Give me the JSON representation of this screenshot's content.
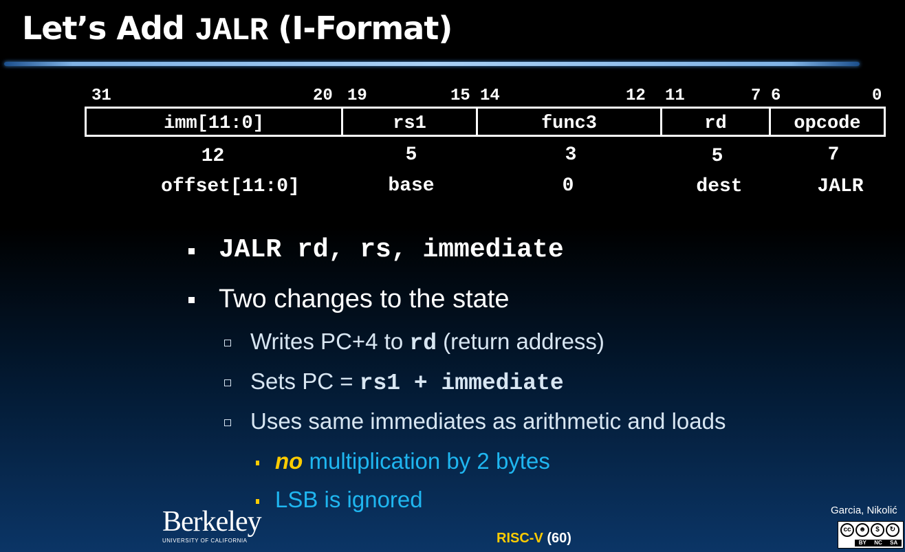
{
  "slide": {
    "title_prefix": "Let’s Add ",
    "title_mono": "JALR",
    "title_suffix": " (I-Format)"
  },
  "format": {
    "bit_labels": [
      "31",
      "20",
      "19",
      "15",
      "14",
      "12",
      "11",
      "7",
      "6",
      "0"
    ],
    "fields": [
      "imm[11:0]",
      "rs1",
      "func3",
      "rd",
      "opcode"
    ],
    "widths": [
      "12",
      "5",
      "3",
      "5",
      "7"
    ],
    "meanings": [
      "offset[11:0]",
      "base",
      "0",
      "dest",
      "JALR"
    ]
  },
  "bullets": {
    "b1": "JALR rd, rs, immediate",
    "b2": "Two changes to the state",
    "b2_1_pre": "Writes PC+4 to ",
    "b2_1_code": "rd",
    "b2_1_post": " (return address)",
    "b2_2_pre": "Sets PC = ",
    "b2_2_code": "rs1 + immediate",
    "b2_3": "Uses same immediates as arithmetic and loads",
    "b3_1_emph": "no",
    "b3_1_rest": " multiplication by 2 bytes",
    "b3_2": "LSB is ignored"
  },
  "footer": {
    "logo_main": "Berkeley",
    "logo_sub": "UNIVERSITY OF CALIFORNIA",
    "center_1": "RISC-V",
    "center_2": " (60)",
    "authors": "Garcia, Nikolić",
    "cc_labels": [
      "BY",
      "NC",
      "SA"
    ]
  },
  "colors": {
    "accent_yellow": "#ffcc00",
    "accent_cyan": "#1fb6f0",
    "text_light": "#d8e6f2",
    "rule_blue": "#a9d0f5"
  }
}
